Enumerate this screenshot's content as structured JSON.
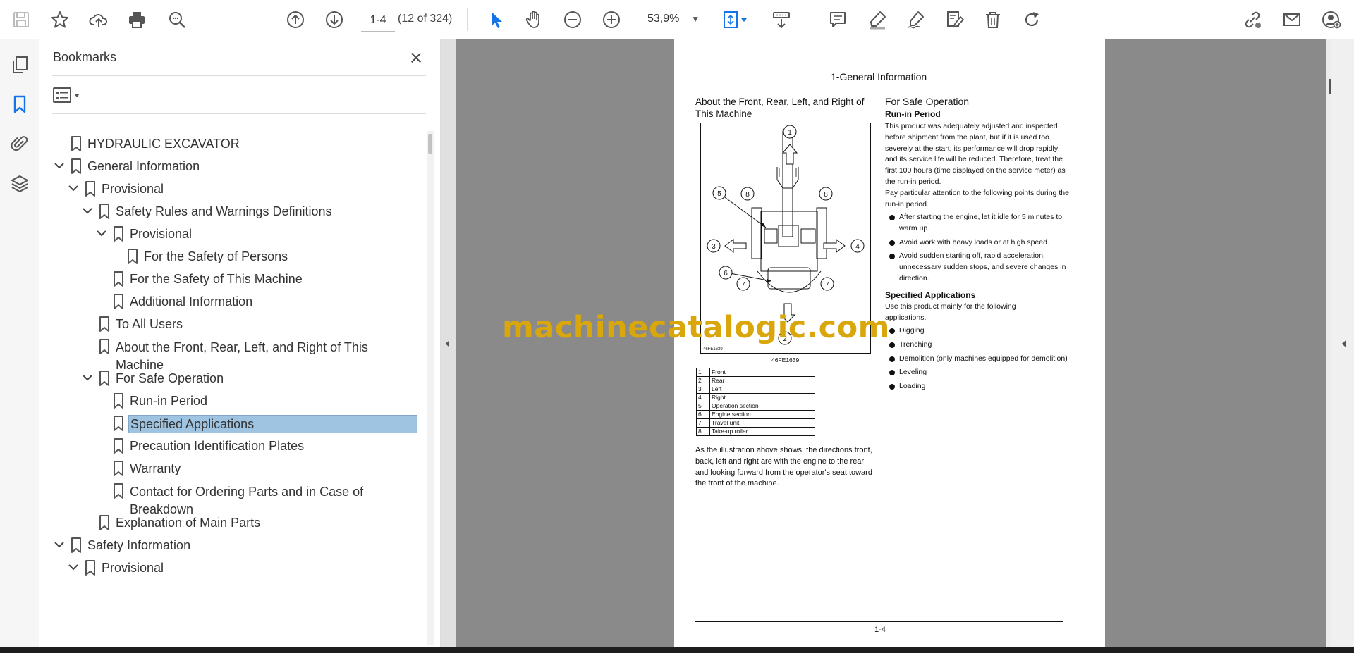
{
  "toolbar": {
    "page_value": "1-4",
    "page_count": "(12 of 324)",
    "zoom": "53,9%"
  },
  "bookmarks": {
    "title": "Bookmarks",
    "items": [
      {
        "label": "HYDRAULIC EXCAVATOR",
        "level": 0,
        "chevron": false
      },
      {
        "label": "General Information",
        "level": 0,
        "chevron": true
      },
      {
        "label": "Provisional",
        "level": 1,
        "chevron": true
      },
      {
        "label": "Safety Rules and Warnings Definitions",
        "level": 2,
        "chevron": true
      },
      {
        "label": "Provisional",
        "level": 3,
        "chevron": true
      },
      {
        "label": "For the Safety of Persons",
        "level": 4,
        "chevron": false
      },
      {
        "label": "For the Safety of This Machine",
        "level": 3,
        "chevron": false
      },
      {
        "label": "Additional Information",
        "level": 3,
        "chevron": false
      },
      {
        "label": "To All Users",
        "level": 2,
        "chevron": false
      },
      {
        "label": "About the Front, Rear, Left, and Right of This Machine",
        "level": 2,
        "chevron": false
      },
      {
        "label": "For Safe Operation",
        "level": 2,
        "chevron": true
      },
      {
        "label": "Run-in Period",
        "level": 3,
        "chevron": false
      },
      {
        "label": "Specified Applications",
        "level": 3,
        "chevron": false,
        "selected": true
      },
      {
        "label": "Precaution Identification Plates",
        "level": 3,
        "chevron": false
      },
      {
        "label": "Warranty",
        "level": 3,
        "chevron": false
      },
      {
        "label": "Contact for Ordering Parts and in Case of Breakdown",
        "level": 3,
        "chevron": false
      },
      {
        "label": "Explanation of Main Parts",
        "level": 2,
        "chevron": false
      },
      {
        "label": "Safety Information",
        "level": 0,
        "chevron": true
      },
      {
        "label": "Provisional",
        "level": 1,
        "chevron": true
      }
    ]
  },
  "page": {
    "header": "1-General Information",
    "left_heading": "About the Front, Rear, Left, and Right of This Machine",
    "figure_code_inner": "46FE1639",
    "figure_code": "46FE1639",
    "callouts": [
      "1",
      "2",
      "3",
      "4",
      "5",
      "6",
      "7",
      "7",
      "8",
      "8"
    ],
    "legend": [
      {
        "no": "1",
        "text": "Front"
      },
      {
        "no": "2",
        "text": "Rear"
      },
      {
        "no": "3",
        "text": "Left"
      },
      {
        "no": "4",
        "text": "Right"
      },
      {
        "no": "5",
        "text": "Operation section"
      },
      {
        "no": "6",
        "text": "Engine section"
      },
      {
        "no": "7",
        "text": "Travel unit"
      },
      {
        "no": "8",
        "text": "Take-up roller"
      }
    ],
    "left_para": "As the illustration above shows, the directions front, back, left and right are with the engine to the rear and looking forward from the operator's seat toward the front of the machine.",
    "right_heading": "For Safe Operation",
    "runin_heading": "Run-in Period",
    "runin_p1": "This product was adequately adjusted and inspected before shipment from the plant, but if it is used too severely at the start, its performance will drop rapidly and its service life will be reduced. Therefore, treat the first 100 hours (time displayed on the service meter) as the run-in period.",
    "runin_p2": "Pay particular attention to the following points during the run-in period.",
    "runin_bullets": [
      "After starting the engine, let it idle for 5 minutes to warm up.",
      "Avoid work with heavy loads or at high speed.",
      "Avoid sudden starting off, rapid acceleration, unnecessary sudden stops, and severe changes in direction."
    ],
    "spec_heading": "Specified Applications",
    "spec_p": "Use this product mainly for the following applications.",
    "spec_bullets": [
      "Digging",
      "Trenching",
      "Demolition (only machines equipped for demolition)",
      "Leveling",
      "Loading"
    ],
    "page_number": "1-4"
  },
  "watermark": "machinecatalogic.com",
  "colors": {
    "accent": "#1473e6",
    "selection": "#9ec4e1",
    "doc_bg": "#8a8a8a",
    "watermark": "#d9a70b"
  }
}
